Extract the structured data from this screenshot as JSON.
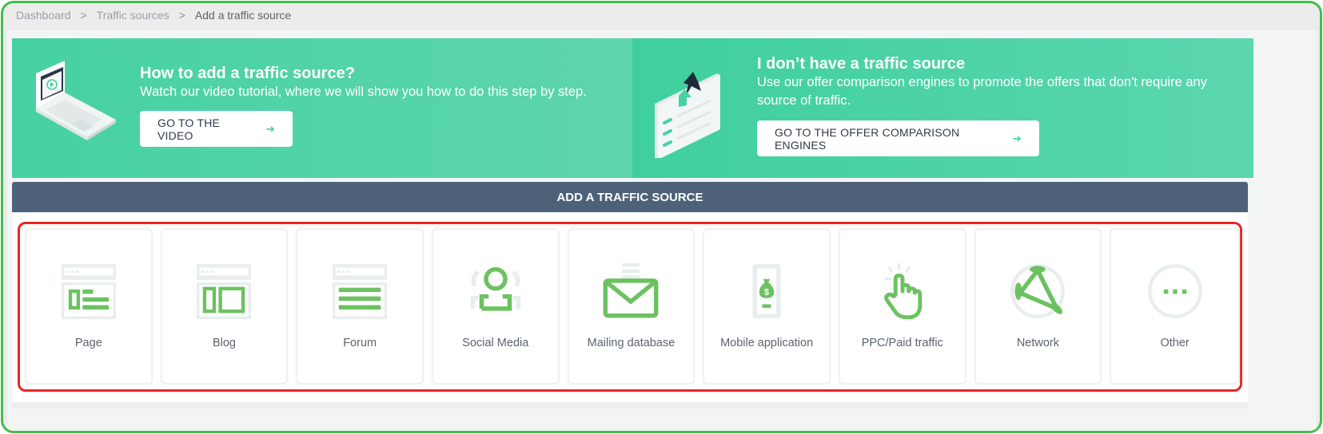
{
  "breadcrumb": {
    "items": [
      "Dashboard",
      "Traffic sources",
      "Add a traffic source"
    ],
    "separator": ">"
  },
  "banners": {
    "video": {
      "title": "How to add a traffic source?",
      "description": "Watch our video tutorial, where we will show you how to do this step by step.",
      "button_label": "GO TO THE VIDEO",
      "button_icon": "arrow-right-icon",
      "illustration": "laptop-play-icon"
    },
    "comparison": {
      "title": "I don’t have a traffic source",
      "description": "Use our offer comparison engines to promote the offers that don't require any source of traffic.",
      "button_label": "GO TO THE OFFER COMPARISON ENGINES",
      "button_icon": "arrow-right-icon",
      "illustration": "list-cursor-icon"
    }
  },
  "section": {
    "title": "ADD A TRAFFIC SOURCE"
  },
  "arrow_glyph": "➔",
  "sources": [
    {
      "label": "Page",
      "icon": "page-layout-icon"
    },
    {
      "label": "Blog",
      "icon": "blog-layout-icon"
    },
    {
      "label": "Forum",
      "icon": "forum-layout-icon"
    },
    {
      "label": "Social Media",
      "icon": "social-user-icon"
    },
    {
      "label": "Mailing database",
      "icon": "envelope-icon"
    },
    {
      "label": "Mobile application",
      "icon": "mobile-money-icon"
    },
    {
      "label": "PPC/Paid traffic",
      "icon": "pointer-click-icon"
    },
    {
      "label": "Network",
      "icon": "network-icon"
    },
    {
      "label": "Other",
      "icon": "more-dots-icon"
    }
  ],
  "colors": {
    "frame": "#45bd4e",
    "accent_green": "#6cc160",
    "banner": "#46d1a2",
    "header_bg": "#4d6178",
    "highlight": "#ee2424"
  }
}
